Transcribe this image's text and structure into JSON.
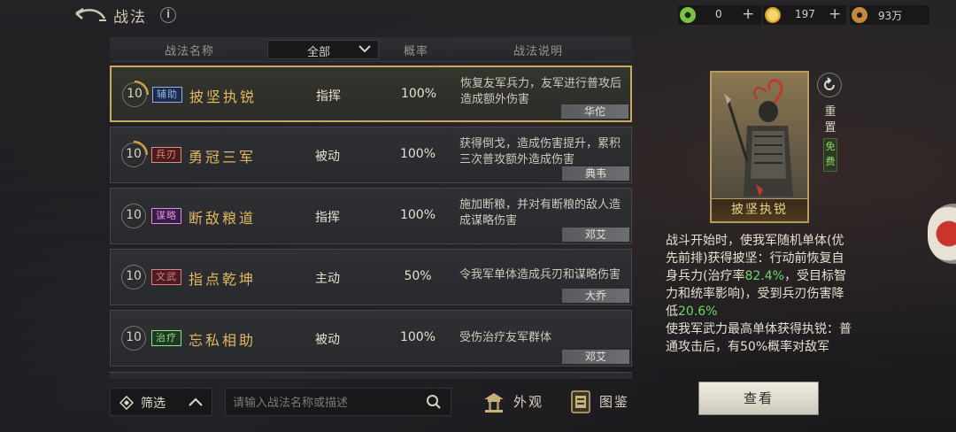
{
  "header": {
    "title": "战法"
  },
  "currencies": [
    {
      "icon": "jade-coin-icon",
      "value": "0",
      "color": "#7bc143"
    },
    {
      "icon": "gold-coin-icon",
      "value": "197",
      "color": "#e7b92c"
    },
    {
      "icon": "copper-coin-icon",
      "value": "93万",
      "color": "#c38a3b"
    }
  ],
  "list_header": {
    "name_col": "战法名称",
    "filter_value": "全部",
    "rate_col": "概率",
    "desc_col": "战法说明"
  },
  "tactics": [
    {
      "level": "10",
      "type": "辅助",
      "type_class": "tag-fuzhu",
      "name": "披坚执锐",
      "kind": "指挥",
      "rate": "100%",
      "desc": "恢复友军兵力，友军进行普攻后造成额外伤害",
      "general": "华佗"
    },
    {
      "level": "10",
      "type": "兵刃",
      "type_class": "tag-bingren",
      "name": "勇冠三军",
      "kind": "被动",
      "rate": "100%",
      "desc": "获得倒戈，造成伤害提升，累积三次普攻额外造成伤害",
      "general": "典韦"
    },
    {
      "level": "10",
      "type": "谋略",
      "type_class": "tag-moulue",
      "name": "断敌粮道",
      "kind": "指挥",
      "rate": "100%",
      "desc": "施加断粮，并对有断粮的敌人造成谋略伤害",
      "general": "邓艾"
    },
    {
      "level": "10",
      "type": "文武",
      "type_class": "tag-wenwu",
      "name": "指点乾坤",
      "kind": "主动",
      "rate": "50%",
      "desc": "令我军单体造成兵刃和谋略伤害",
      "general": "大乔"
    },
    {
      "level": "10",
      "type": "治疗",
      "type_class": "tag-zhiliao",
      "name": "忘私相助",
      "kind": "被动",
      "rate": "100%",
      "desc": "受伤治疗友军群体",
      "general": "邓艾"
    }
  ],
  "bottom": {
    "filter_label": "筛选",
    "search_placeholder": "请输入战法名称或描述",
    "appearance_label": "外观",
    "catalog_label": "图鉴"
  },
  "detail": {
    "card_name": "披坚执锐",
    "reset_label": "重置",
    "free_label": "免费",
    "text_1": "战斗开始时，使我军随机单体(优先前排)获得披坚：行动前恢复自身兵力(治疗率",
    "heal_rate": "82.4%",
    "text_2": "，受目标智力和统率影响)，受到兵刃伤害降低",
    "dmg_reduce": "20.6%",
    "text_3": "使我军武力最高单体获得执锐：普通攻击后，有50%概率对敌军",
    "view_label": "查看"
  }
}
